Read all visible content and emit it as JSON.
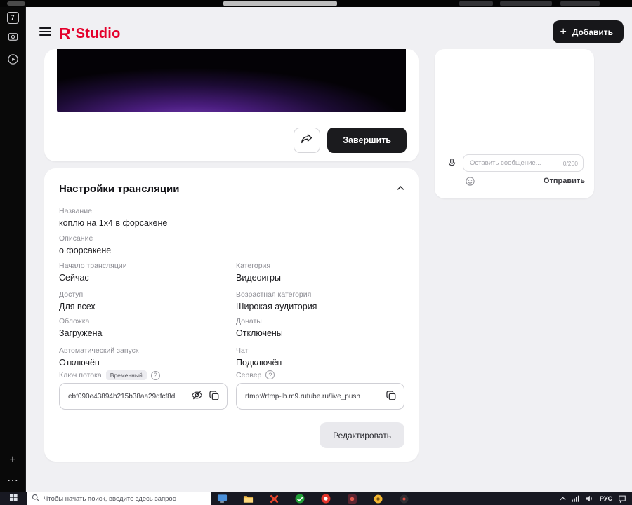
{
  "icons": {
    "plus_glyph": "+",
    "more_glyph": "⋯",
    "help_glyph": "?"
  },
  "left_rail": {
    "tab_counter": "7"
  },
  "header": {
    "logo_r": "R",
    "logo_text": "Studio",
    "add_button": "Добавить"
  },
  "player": {
    "finish_button": "Завершить"
  },
  "chat": {
    "message_placeholder": "Оставить сообщение...",
    "char_counter": "0/200",
    "send_button": "Отправить"
  },
  "settings": {
    "title": "Настройки трансляции",
    "fields": [
      {
        "label": "Название",
        "value": "коплю на 1х4 в форсакене"
      },
      {
        "label": "Описание",
        "value": "о форсакене"
      },
      {
        "label": "Начало трансляции",
        "value": "Сейчас"
      },
      {
        "label": "Категория",
        "value": "Видеоигры"
      },
      {
        "label": "Доступ",
        "value": "Для всех"
      },
      {
        "label": "Возрастная категория",
        "value": "Широкая аудитория"
      },
      {
        "label": "Обложка",
        "value": "Загружена"
      },
      {
        "label": "Донаты",
        "value": "Отключены"
      },
      {
        "label": "Автоматический запуск",
        "value": "Отключён"
      },
      {
        "label": "Чат",
        "value": "Подключён"
      }
    ],
    "stream_key": {
      "label": "Ключ потока",
      "badge": "Временный",
      "value": "ebf090e43894b215b38aa29dfcf8d"
    },
    "server": {
      "label": "Сервер",
      "value": "rtmp://rtmp-lb.m9.rutube.ru/live_push"
    },
    "edit_button": "Редактировать"
  },
  "taskbar": {
    "search_placeholder": "Чтобы начать поиск, введите здесь запрос",
    "language": "РУС"
  },
  "colors": {
    "brand_red": "#e4002b",
    "dark_button": "#1b1b1e"
  }
}
